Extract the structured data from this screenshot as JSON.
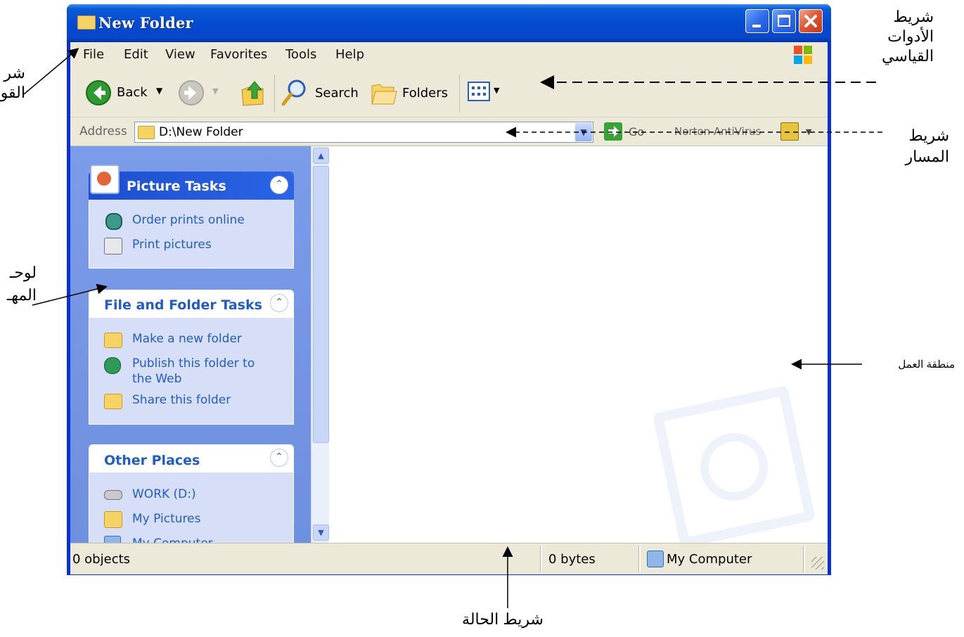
{
  "window": {
    "title": "New Folder"
  },
  "menu": [
    "File",
    "Edit",
    "View",
    "Favorites",
    "Tools",
    "Help"
  ],
  "toolbar": {
    "back": "Back",
    "search": "Search",
    "folders": "Folders"
  },
  "address": {
    "label": "Address",
    "path": "D:\\New Folder",
    "go": "Go",
    "norton": "Norton AntiVirus"
  },
  "tasks": {
    "picture": {
      "title": "Picture Tasks",
      "items": [
        "Order prints online",
        "Print pictures"
      ]
    },
    "file_folder": {
      "title": "File and Folder Tasks",
      "items": [
        "Make a new folder",
        "Publish this folder to",
        "the Web",
        "Share this folder"
      ]
    },
    "other": {
      "title": "Other Places",
      "items": [
        "WORK (D:)",
        "My Pictures",
        "My Computer"
      ]
    }
  },
  "status": {
    "objects": "0 objects",
    "bytes": "0 bytes",
    "location": "My Computer"
  },
  "annotations": {
    "standard_toolbar": [
      "شريط",
      "الأدوات",
      "القياسي"
    ],
    "address_bar": [
      "شريط",
      "المسار"
    ],
    "work_area": "منطقة العمل",
    "status_bar": "شريط الحالة",
    "menu_bar": [
      "شر",
      "القو"
    ],
    "task_pane": [
      "لوحـ",
      "المهـ"
    ]
  },
  "colors": {
    "title_bar": "#0a5ad6",
    "task_pane": "#7b9ce9",
    "panel_body": "#d6dff7",
    "link": "#215dc6",
    "chrome": "#ece9d8"
  }
}
